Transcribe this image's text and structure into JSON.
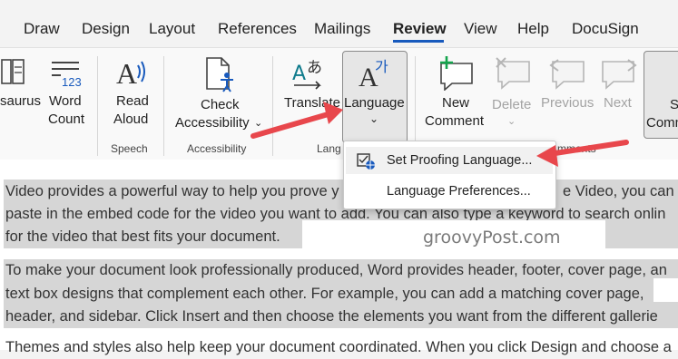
{
  "tabs": {
    "draw": "Draw",
    "design": "Design",
    "layout": "Layout",
    "references": "References",
    "mailings": "Mailings",
    "review": "Review",
    "view": "View",
    "help": "Help",
    "docusign": "DocuSign"
  },
  "ribbon": {
    "thesaurus": "saurus",
    "word_count_1": "Word",
    "word_count_2": "Count",
    "word_count_glyph": "123",
    "read_aloud_1": "Read",
    "read_aloud_2": "Aloud",
    "check_access_1": "Check",
    "check_access_2": "Accessibility",
    "translate": "Translate",
    "language": "Language",
    "new_comment_1": "New",
    "new_comment_2": "Comment",
    "delete": "Delete",
    "previous": "Previous",
    "next": "Next",
    "show_1": "Sh",
    "show_2": "Comm",
    "groups": {
      "speech": "Speech",
      "accessibility": "Accessibility",
      "language_partial": "Lang",
      "comments_partial": "mments"
    }
  },
  "dropdown": {
    "set_proofing": "Set Proofing Language...",
    "language_prefs": "Language Preferences..."
  },
  "document": {
    "line1": "Video provides a powerful way to help you prove y",
    "line1b": "e Video, you can",
    "line2": "paste in the embed code for the video you want to add. You can also type a keyword to search onlin",
    "line3": "for the video that best fits your document.",
    "line4": "To make your document look professionally produced, Word provides header, footer, cover page, an",
    "line5": "text box designs that complement each other. For example, you can add a matching cover page,",
    "line6": "header, and sidebar. Click Insert and then choose the elements you want from the different gallerie",
    "line7": "Themes and styles also help keep your document coordinated. When you click Design and choose a"
  },
  "watermark": "groovyPost.com",
  "colors": {
    "accent": "#185abd",
    "arrow": "#e8474c",
    "highlight": "#d6d6d6",
    "teal": "#0f7b8c"
  }
}
